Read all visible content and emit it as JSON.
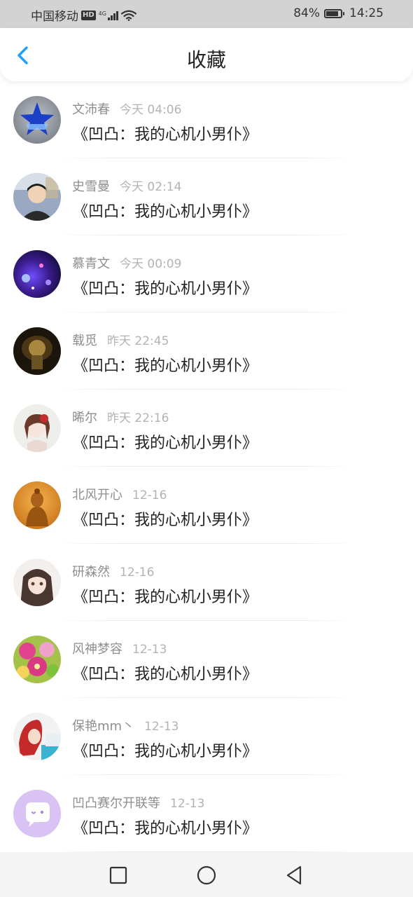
{
  "status_bar": {
    "carrier": "中国移动",
    "hd_badge": "HD",
    "network_type": "4G",
    "battery_percent": "84%",
    "battery_level": 0.84,
    "time": "14:25",
    "icons": [
      "hd-icon",
      "signal-icon",
      "wifi-icon",
      "battery-icon"
    ]
  },
  "header": {
    "title": "收藏",
    "back_icon": "back-arrow-icon",
    "accent_color": "#1a9fff"
  },
  "items": [
    {
      "name": "文沛春",
      "time": "今天 04:06",
      "text": "《凹凸：我的心机小男仆》",
      "avatar": "blue-star-avatar"
    },
    {
      "name": "史雪曼",
      "time": "今天 02:14",
      "text": "《凹凸：我的心机小男仆》",
      "avatar": "boy-photo-avatar"
    },
    {
      "name": "慕青文",
      "time": "今天 00:09",
      "text": "《凹凸：我的心机小男仆》",
      "avatar": "purple-lights-avatar"
    },
    {
      "name": "载觅",
      "time": "昨天 22:45",
      "text": "《凹凸：我的心机小男仆》",
      "avatar": "golden-figure-avatar"
    },
    {
      "name": "晞尔",
      "time": "昨天 22:16",
      "text": "《凹凸：我的心机小男仆》",
      "avatar": "anime-girl-avatar"
    },
    {
      "name": "北风开心",
      "time": "12-16",
      "text": "《凹凸：我的心机小男仆》",
      "avatar": "buddha-avatar"
    },
    {
      "name": "研森然",
      "time": "12-16",
      "text": "《凹凸：我的心机小男仆》",
      "avatar": "anime-girl-dark-avatar"
    },
    {
      "name": "风神梦容",
      "time": "12-13",
      "text": "《凹凸：我的心机小男仆》",
      "avatar": "flowers-avatar"
    },
    {
      "name": "保艳mm丶",
      "time": "12-13",
      "text": "《凹凸：我的心机小男仆》",
      "avatar": "red-hair-avatar"
    },
    {
      "name": "凹凸赛尔开联等",
      "time": "12-13",
      "text": "《凹凸：我的心机小男仆》",
      "avatar": "chat-bubble-avatar"
    }
  ],
  "nav_bar": {
    "buttons": [
      "recent-apps-icon",
      "home-icon",
      "back-triangle-icon"
    ]
  }
}
